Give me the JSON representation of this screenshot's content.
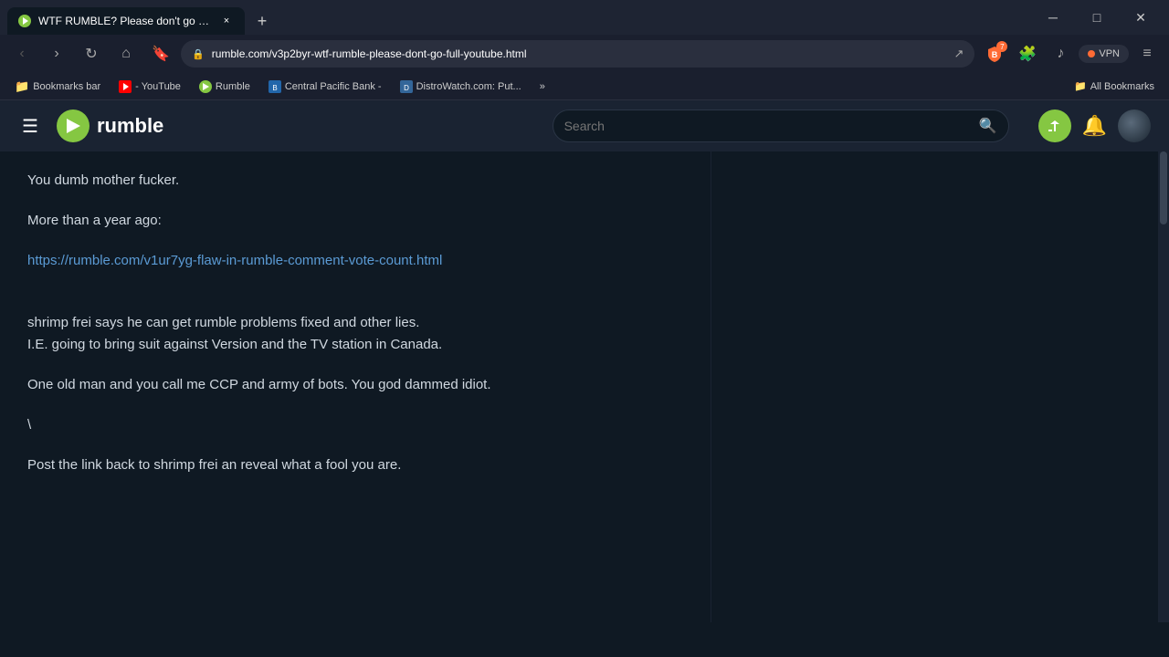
{
  "browser": {
    "tab": {
      "title": "WTF RUMBLE? Please don't go FUL",
      "close_label": "×"
    },
    "new_tab_label": "+",
    "address": "rumble.com/v3p2byr-wtf-rumble-please-dont-go-full-youtube.html",
    "nav": {
      "back": "‹",
      "forward": "›",
      "reload": "↻",
      "home": "⌂",
      "bookmark": "🔖"
    },
    "extensions": {
      "brave_count": "7",
      "vpn_label": "VPN"
    },
    "menu_label": "≡"
  },
  "bookmarks": {
    "bar_label": "Bookmarks bar",
    "items": [
      {
        "label": "Bookmarks bar",
        "type": "folder"
      },
      {
        "label": "- YouTube",
        "type": "link",
        "icon": "youtube"
      },
      {
        "label": "Rumble",
        "type": "link",
        "icon": "rumble"
      },
      {
        "label": "Central Pacific Bank -",
        "type": "link",
        "icon": "bank"
      },
      {
        "label": "DistroWatch.com: Put...",
        "type": "link",
        "icon": "distro"
      }
    ],
    "more_label": "»",
    "all_bookmarks_label": "All Bookmarks"
  },
  "rumble": {
    "logo_text": "rumble",
    "search_placeholder": "Search",
    "header_actions": {
      "upload_icon": "+▶",
      "notification_icon": "🔔"
    }
  },
  "comment": {
    "lines": [
      {
        "text": "You dumb mother fucker.",
        "type": "paragraph"
      },
      {
        "text": "More than a year ago:",
        "type": "paragraph"
      },
      {
        "text": "https://rumble.com/v1ur7yg-flaw-in-rumble-comment-vote-count.html",
        "type": "link"
      },
      {
        "text": "",
        "type": "spacer"
      },
      {
        "text": "shrimp frei says he can get rumble problems fixed and other lies.",
        "type": "text"
      },
      {
        "text": "I.E. going to bring suit against Version and the TV station in Canada.",
        "type": "paragraph"
      },
      {
        "text": "One old man and you call me CCP and army of bots. You god dammed idiot.",
        "type": "paragraph"
      },
      {
        "text": "\\",
        "type": "paragraph"
      },
      {
        "text": "Post the link back to shrimp frei an reveal what a fool you are.",
        "type": "text"
      }
    ]
  }
}
